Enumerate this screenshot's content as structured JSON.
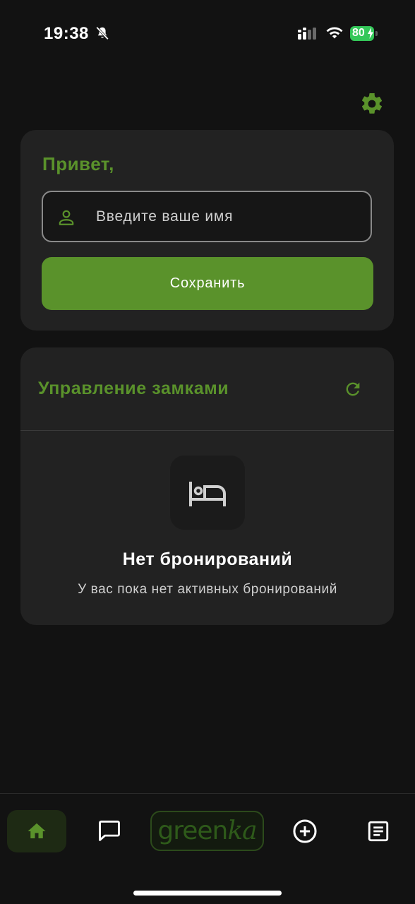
{
  "status_bar": {
    "time": "19:38",
    "battery": "80"
  },
  "colors": {
    "accent": "#5a922b",
    "background": "#121212",
    "card": "#222222",
    "battery_green": "#34c759"
  },
  "header": {
    "settings_icon": "gear-icon"
  },
  "profile_card": {
    "greeting": "Привет,",
    "name_placeholder": "Введите ваше имя",
    "name_value": "",
    "save_label": "Сохранить"
  },
  "locks_card": {
    "title": "Управление замками",
    "refresh_icon": "refresh-icon",
    "empty_icon": "bed-icon",
    "empty_title": "Нет бронирований",
    "empty_subtitle": "У вас пока нет активных бронирований"
  },
  "bottom_nav": {
    "items": [
      {
        "icon": "home-icon",
        "active": true
      },
      {
        "icon": "chat-icon",
        "active": false
      },
      {
        "icon": "logo",
        "active": false
      },
      {
        "icon": "add-circle-icon",
        "active": false
      },
      {
        "icon": "list-icon",
        "active": false
      }
    ],
    "logo": {
      "part1": "green",
      "part2": "ka"
    }
  }
}
